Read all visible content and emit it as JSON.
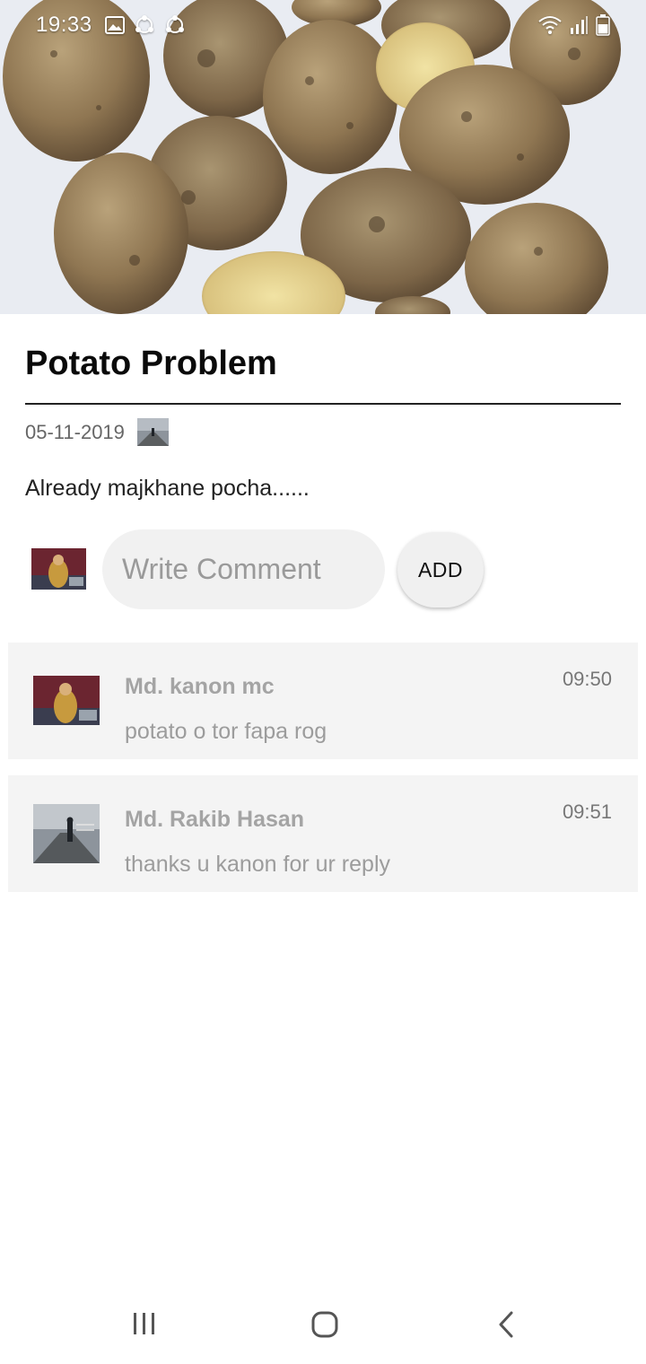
{
  "status_bar": {
    "time": "19:33",
    "left_icons": [
      "gallery-icon",
      "sync-icon",
      "sync-icon"
    ],
    "right_icons": [
      "wifi-icon",
      "signal-icon",
      "battery-icon"
    ]
  },
  "post": {
    "title": "Potato Problem",
    "date": "05-11-2019",
    "body": "Already majkhane pocha......"
  },
  "composer": {
    "placeholder": "Write Comment",
    "add_label": "ADD"
  },
  "comments": [
    {
      "name": "Md. kanon mc",
      "text": "potato o tor fapa rog",
      "time": "09:50"
    },
    {
      "name": "Md. Rakib Hasan",
      "text": "thanks u kanon for ur reply",
      "time": "09:51"
    }
  ],
  "navigation": [
    "recents-icon",
    "home-icon",
    "back-icon"
  ],
  "colors": {
    "card_background": "#f4f4f4",
    "input_background": "#f1f1f1",
    "comment_name": "#a4a4a4",
    "comment_text": "#9c9c9c"
  }
}
